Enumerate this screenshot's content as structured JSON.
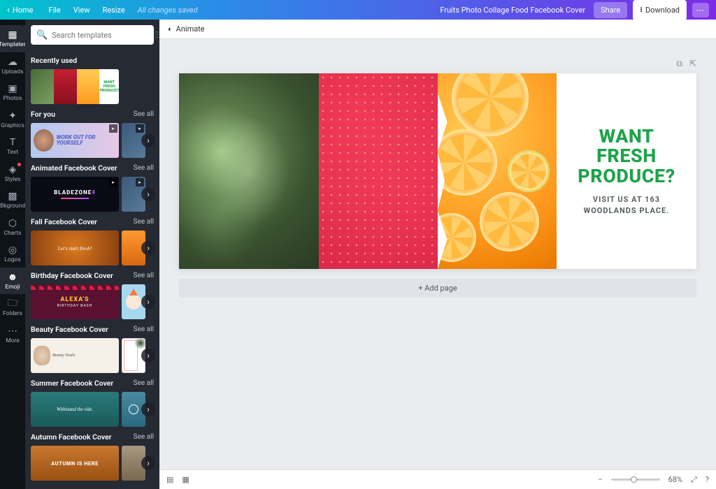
{
  "topbar": {
    "home": "Home",
    "menu": [
      "File",
      "View",
      "Resize"
    ],
    "saved": "All changes saved",
    "doctitle": "Fruits Photo Collage Food Facebook Cover",
    "share": "Share",
    "download": "Download"
  },
  "rail": [
    {
      "icon": "▦",
      "label": "Templates",
      "active": true
    },
    {
      "icon": "☁",
      "label": "Uploads"
    },
    {
      "icon": "▣",
      "label": "Photos"
    },
    {
      "icon": "✦",
      "label": "Graphics"
    },
    {
      "icon": "T",
      "label": "Text"
    },
    {
      "icon": "◈",
      "label": "Styles",
      "dot": true
    },
    {
      "icon": "▩",
      "label": "Bkground"
    },
    {
      "icon": "⬡",
      "label": "Charts"
    },
    {
      "icon": "◎",
      "label": "Logos"
    },
    {
      "icon": "☻",
      "label": "Emoji",
      "active": true
    },
    {
      "icon": "🗀",
      "label": "Folders"
    },
    {
      "icon": "⋯",
      "label": "More"
    }
  ],
  "search": {
    "placeholder": "Search templates"
  },
  "sections": {
    "recent": {
      "title": "Recently used",
      "thumb_text": "WANT FRESH PRODUCE?"
    },
    "foryou": {
      "title": "For you",
      "see": "See all",
      "thumb1": "WORK OUT FOR YOURSELF"
    },
    "animated": {
      "title": "Animated Facebook Cover",
      "see": "See all",
      "thumb1_a": "BLADEZONE",
      "thumb1_b": "4"
    },
    "fall": {
      "title": "Fall Facebook Cover",
      "see": "See all",
      "thumb1": "Let's start fresh!"
    },
    "birthday": {
      "title": "Birthday Facebook Cover",
      "see": "See all",
      "name": "ALEXA'S",
      "sub": "BIRTHDAY BASH"
    },
    "beauty": {
      "title": "Beauty Facebook Cover",
      "see": "See all",
      "thumb1": "Beauty Steals"
    },
    "summer": {
      "title": "Summer Facebook Cover",
      "see": "See all",
      "thumb1": "Withstand the tide."
    },
    "autumn": {
      "title": "Autumn Facebook Cover",
      "see": "See all",
      "thumb1": "AUTUMN IS HERE"
    }
  },
  "canvas": {
    "animate": "Animate",
    "heading_l1": "WANT",
    "heading_l2": "FRESH",
    "heading_l3": "PRODUCE?",
    "sub_l1": "VISIT US AT 163",
    "sub_l2": "WOODLANDS PLACE.",
    "add_page": "+ Add page"
  },
  "bottom": {
    "zoom": "68%"
  }
}
